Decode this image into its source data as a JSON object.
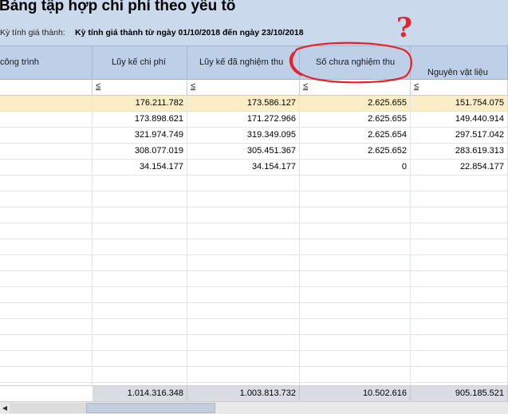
{
  "report": {
    "title": "Bảng tập hợp chi phí theo yếu tố",
    "period_label": "Kỳ tính giá thành:",
    "period_value": "Kỳ tính giá thành từ ngày 01/10/2018 đến ngày 23/10/2018"
  },
  "columns": [
    {
      "label": "công trình"
    },
    {
      "label": "Lũy kế chi phí"
    },
    {
      "label": "Lũy kế đã nghiệm thu"
    },
    {
      "label": "Số chưa nghiệm thu"
    },
    {
      "label": "Nguyên vật liệu"
    }
  ],
  "filter_operator": "≤",
  "rows": [
    [
      "",
      "176.211.782",
      "173.586.127",
      "2.625.655",
      "151.754.075"
    ],
    [
      "",
      "173.898.621",
      "171.272.966",
      "2.625.655",
      "149.440.914"
    ],
    [
      "",
      "321.974.749",
      "319.349.095",
      "2.625.654",
      "297.517.042"
    ],
    [
      "",
      "308.077.019",
      "305.451.367",
      "2.625.652",
      "283.619.313"
    ],
    [
      "",
      "34.154.177",
      "34.154.177",
      "0",
      "22.854.177"
    ]
  ],
  "totals": [
    "",
    "1.014.316.348",
    "1.003.813.732",
    "10.502.616",
    "905.185.521"
  ],
  "annotation": {
    "mark": "?",
    "color": "#e8222a"
  },
  "scrollbar": {
    "left_arrow_icon": "◀"
  }
}
